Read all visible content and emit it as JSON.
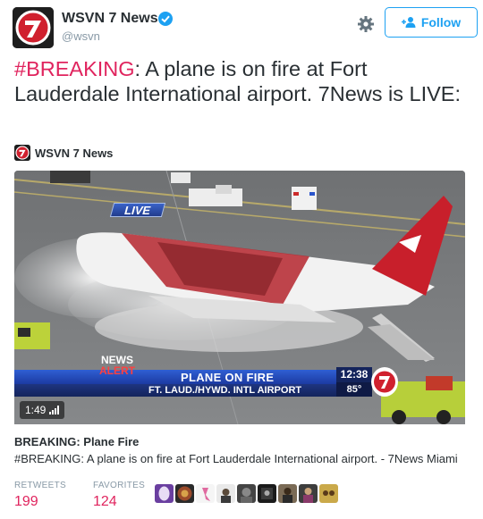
{
  "account": {
    "name": "WSVN 7 News",
    "handle": "@wsvn",
    "verified": true,
    "avatar_icon": "wsvn-7-logo"
  },
  "header": {
    "settings_icon": "gear-icon",
    "follow_label": "Follow"
  },
  "tweet": {
    "hashtag": "#BREAKING",
    "text": ": A plane is on fire at Fort Lauderdale International airport. 7News is LIVE:"
  },
  "media": {
    "source_name": "WSVN 7 News",
    "duration": "1:49",
    "overlay": {
      "live": "LIVE",
      "news": "NEWS",
      "alert": "ALERT",
      "headline": "PLANE ON FIRE",
      "subhead": "FT. LAUD./HYWD. INTL AIRPORT",
      "time": "12:38",
      "temperature": "85°"
    }
  },
  "card": {
    "title": "BREAKING: Plane Fire",
    "description": "#BREAKING: A plane is on fire at Fort Lauderdale International airport. - 7News Miami"
  },
  "stats": {
    "retweets_label": "RETWEETS",
    "retweets": "199",
    "favorites_label": "FAVORITES",
    "favorites": "124"
  },
  "colors": {
    "accent": "#1da1f2",
    "hashtag": "#e0245e",
    "text": "#292f33",
    "muted": "#8899a6"
  }
}
